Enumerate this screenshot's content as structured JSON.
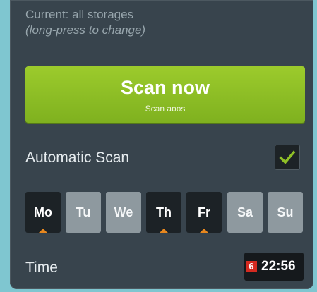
{
  "storage": {
    "current": "Current: all storages",
    "hint": "(long-press to change)"
  },
  "scan_button": {
    "title": "Scan now",
    "subtitle": "Scan apps"
  },
  "automatic_scan": {
    "label": "Automatic Scan",
    "checked": true,
    "icon": "checkmark-icon"
  },
  "days": [
    {
      "label": "Mo",
      "selected": true
    },
    {
      "label": "Tu",
      "selected": false
    },
    {
      "label": "We",
      "selected": false
    },
    {
      "label": "Th",
      "selected": true
    },
    {
      "label": "Fr",
      "selected": true
    },
    {
      "label": "Sa",
      "selected": false
    },
    {
      "label": "Su",
      "selected": false
    }
  ],
  "time": {
    "label": "Time",
    "value": "22:56",
    "callout_number": "6"
  },
  "colors": {
    "accent_green": "#8fc026",
    "check_green": "#8fc026",
    "day_marker_orange": "#e7871e",
    "callout_red": "#d42a20",
    "panel_bg": "#38444d"
  }
}
